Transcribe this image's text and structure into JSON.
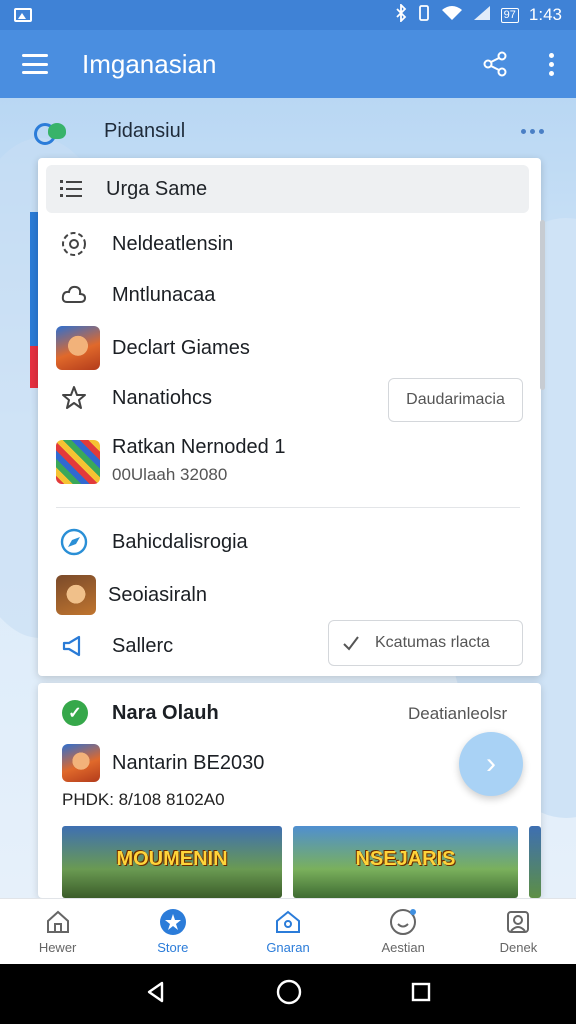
{
  "status_bar": {
    "time": "1:43",
    "battery": "97"
  },
  "app_bar": {
    "title": "Imganasian"
  },
  "subheader": {
    "title": "Pidansiul"
  },
  "menu": {
    "header_label": "Urga Same",
    "items": [
      {
        "label": "Neldeatlensin",
        "icon": "gear-icon"
      },
      {
        "label": "Mntlunacaa",
        "icon": "cloud-icon"
      },
      {
        "label": "Declart Giames",
        "icon": "game-fox-icon"
      },
      {
        "label": "Nanatiohcs",
        "icon": "star-icon",
        "button": "Daudarimacia"
      },
      {
        "label": "Ratkan Nernoded 1",
        "sub": "00Ulaah 32080",
        "icon": "puzzle-game-icon"
      },
      {
        "label": "Bahicdalisrogia",
        "icon": "compass-icon"
      },
      {
        "label": "Seoiasiraln",
        "icon": "game-hero-icon"
      },
      {
        "label": "Sallerc",
        "icon": "megaphone-icon",
        "button": "Kcatumas rlacta"
      }
    ]
  },
  "feed": {
    "title": "Nara Olauh",
    "right_label": "Deatianleolsr",
    "game_title": "Nantarin BE2030",
    "game_meta": "PHDK: 8/108  8102A0",
    "banners": [
      "MOUMENIN",
      "NSEJARIS"
    ]
  },
  "bottom_nav": [
    {
      "label": "Hewer",
      "icon": "home-icon",
      "active": false
    },
    {
      "label": "Store",
      "icon": "store-icon",
      "active": true
    },
    {
      "label": "Gnaran",
      "icon": "house-icon",
      "active": false
    },
    {
      "label": "Aestian",
      "icon": "face-icon",
      "active": false
    },
    {
      "label": "Denek",
      "icon": "profile-icon",
      "active": false
    }
  ],
  "colors": {
    "primary": "#4a8ee0",
    "status_bar": "#3f82d6",
    "accent_red": "#e53040",
    "accent_green": "#36a84a"
  }
}
